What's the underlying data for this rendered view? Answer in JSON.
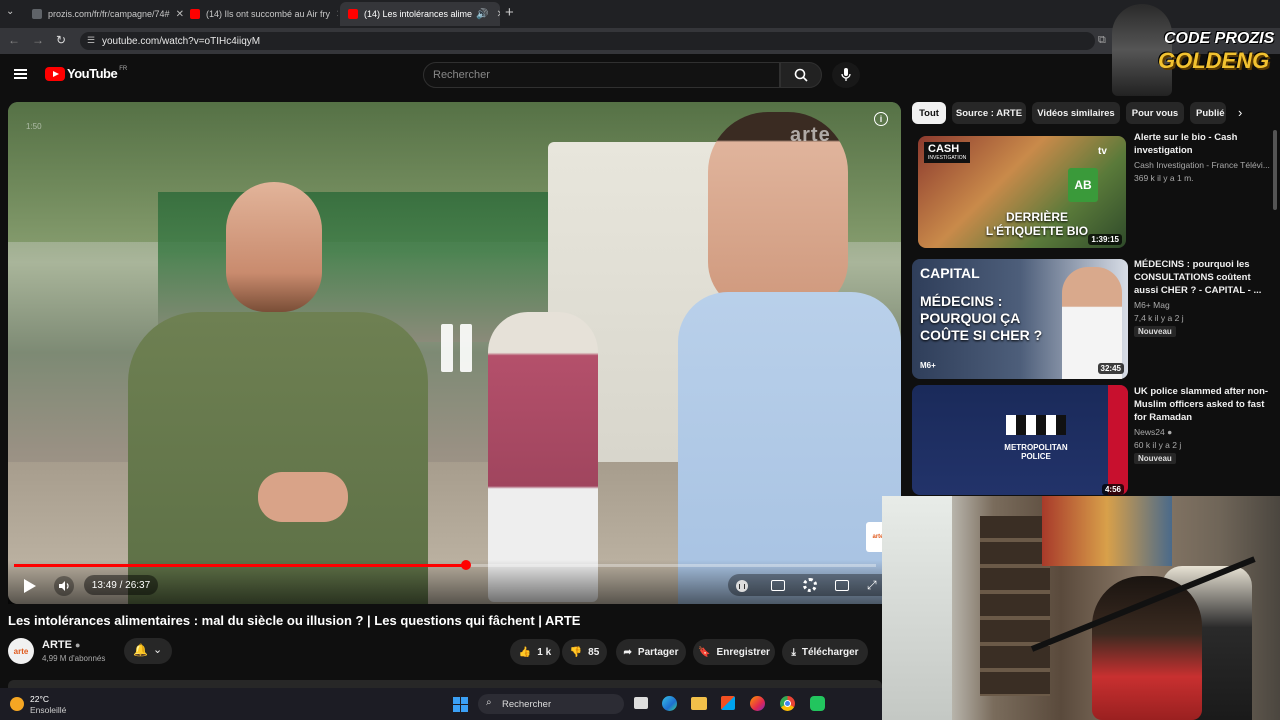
{
  "browser": {
    "tabs": [
      {
        "label": "prozis.com/fr/fr/campagne/74#",
        "active": false
      },
      {
        "label": "(14) Ils ont succombé au Air fry",
        "active": false
      },
      {
        "label": "(14) Les intolérances alime",
        "active": true
      }
    ],
    "url": "youtube.com/watch?v=oTIHc4iiqyM"
  },
  "youtube": {
    "logo_text": "YouTube",
    "country_code": "FR",
    "search_placeholder": "Rechercher"
  },
  "player": {
    "progress_fraction": 0.524,
    "time_display": "13:49 / 26:37",
    "overlay_watermark": "arte",
    "corner_time": "1:50"
  },
  "video": {
    "title": "Les intolérances alimentaires : mal du siècle ou illusion ? | Les questions qui fâchent | ARTE",
    "channel_logo": "arte",
    "channel_name": "ARTE",
    "subscribers": "4,99 M d'abonnés",
    "likes": "1 k",
    "dislikes": "85",
    "share_label": "Partager",
    "save_label": "Enregistrer",
    "download_label": "Télécharger"
  },
  "chips": [
    "Tout",
    "Source : ARTE",
    "Vidéos similaires",
    "Pour vous",
    "Publié"
  ],
  "recommendations": [
    {
      "title": "Alerte sur le bio - Cash investigation",
      "channel": "Cash Investigation - France Télévi...",
      "meta": "369 k   il y a 1 m.",
      "duration": "1:39:15",
      "thumb_caption": "DERRIÈRE L'ÉTIQUETTE BIO",
      "thumb_brand": "CASH",
      "thumb_brand2": "INVESTIGATION",
      "thumb_corner": "tv",
      "thumb_logo": "AB",
      "badge": ""
    },
    {
      "title": "MÉDECINS : pourquoi les CONSULTATIONS coûtent aussi CHER ? - CAPITAL - ...",
      "channel": "M6+ Mag",
      "meta": "7,4 k   il y a 2 j",
      "duration": "32:45",
      "thumb_caption": "MÉDECINS : POURQUOI ÇA COÛTE SI CHER ?",
      "thumb_brand": "CAPITAL",
      "thumb_corner": "",
      "thumb_footer": "M6+",
      "badge": "Nouveau"
    },
    {
      "title": "UK police slammed after non-Muslim officers asked to fast for Ramadan",
      "channel": "News24",
      "meta": "60 k   il y a 2 j",
      "duration": "4:56",
      "thumb_caption": "METROPOLITAN POLICE",
      "thumb_brand": "",
      "thumb_corner": "",
      "badge": "Nouveau"
    }
  ],
  "overlay_logo": {
    "line1": "CODE PROZIS",
    "line2": "GOLDENG"
  },
  "taskbar": {
    "temperature": "22°C",
    "weather": "Ensoleillé",
    "search": "Rechercher"
  },
  "colors": {
    "accent": "#ff0000",
    "bg": "#0f0f0f",
    "chip": "#272727",
    "logo_gold": "#f2c230"
  }
}
